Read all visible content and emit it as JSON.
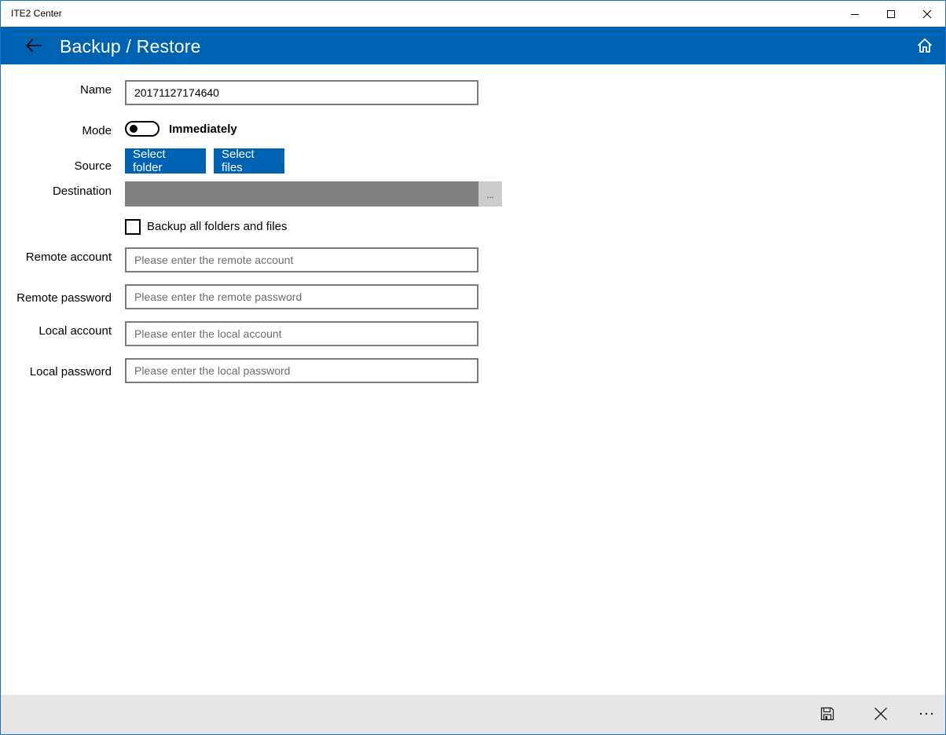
{
  "window": {
    "title": "ITE2 Center",
    "controls": [
      "minimize",
      "maximize",
      "close"
    ]
  },
  "header": {
    "title": "Backup / Restore",
    "back_icon": "arrow-left-icon",
    "home_icon": "home-icon"
  },
  "form": {
    "name": {
      "label": "Name",
      "value": "20171127174640"
    },
    "mode": {
      "label": "Mode",
      "toggle_on": false,
      "toggle_text": "Immediately"
    },
    "source": {
      "label": "Source",
      "select_folder": "Select folder",
      "select_files": "Select files"
    },
    "destination": {
      "label": "Destination",
      "value": "",
      "browse_label": "..."
    },
    "backup_all": {
      "label": "Backup all folders and files",
      "checked": false
    },
    "remote_account": {
      "label": "Remote account",
      "placeholder": "Please enter the remote account",
      "value": ""
    },
    "remote_password": {
      "label": "Remote password",
      "placeholder": "Please enter the remote password",
      "value": ""
    },
    "local_account": {
      "label": "Local account",
      "placeholder": "Please enter the local account",
      "value": ""
    },
    "local_password": {
      "label": "Local password",
      "placeholder": "Please enter the local password",
      "value": ""
    }
  },
  "command_bar": {
    "save_icon": "save-icon",
    "cancel_icon": "close-icon",
    "more_icon": "more-icon",
    "more_label": "..."
  },
  "colors": {
    "accent": "#0063b1",
    "destination_bg": "#808080",
    "command_bar_bg": "#e6e6e6"
  }
}
